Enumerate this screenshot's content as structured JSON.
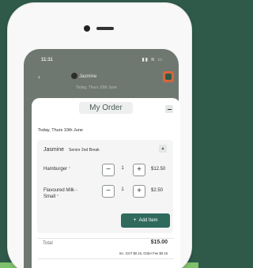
{
  "status_bar": {
    "time": "11:11",
    "icons": "▮▮ ≋ ▭"
  },
  "header": {
    "back_icon": "chevron-left-icon",
    "name": "Jasmine",
    "subtitle": "Today, Thurs 10th June"
  },
  "modal": {
    "title": "My Order",
    "date_line": "Today, Thurs 10th June",
    "student": {
      "name": "Jasmine",
      "break": "Senior 2nd Break"
    },
    "items": [
      {
        "name": "Hamburger",
        "required_marker": "*",
        "qty": "1",
        "price": "$12.50",
        "minus": "−",
        "plus": "+"
      },
      {
        "name": "Flavoured Milk - Small",
        "required_marker": "*",
        "qty": "1",
        "price": "$2.50",
        "minus": "−",
        "plus": "+"
      }
    ],
    "add_item_label": "Add Item",
    "add_item_icon": "plus-icon",
    "total_label": "Total",
    "total_value": "$15.00",
    "total_note": "Inc. GST $0.15, Order Fee $0.15"
  },
  "colors": {
    "background": "#2f5a4a",
    "accent": "#2f6a5d",
    "required": "#e0645a",
    "bottom_stripe": "#7fc06a"
  }
}
